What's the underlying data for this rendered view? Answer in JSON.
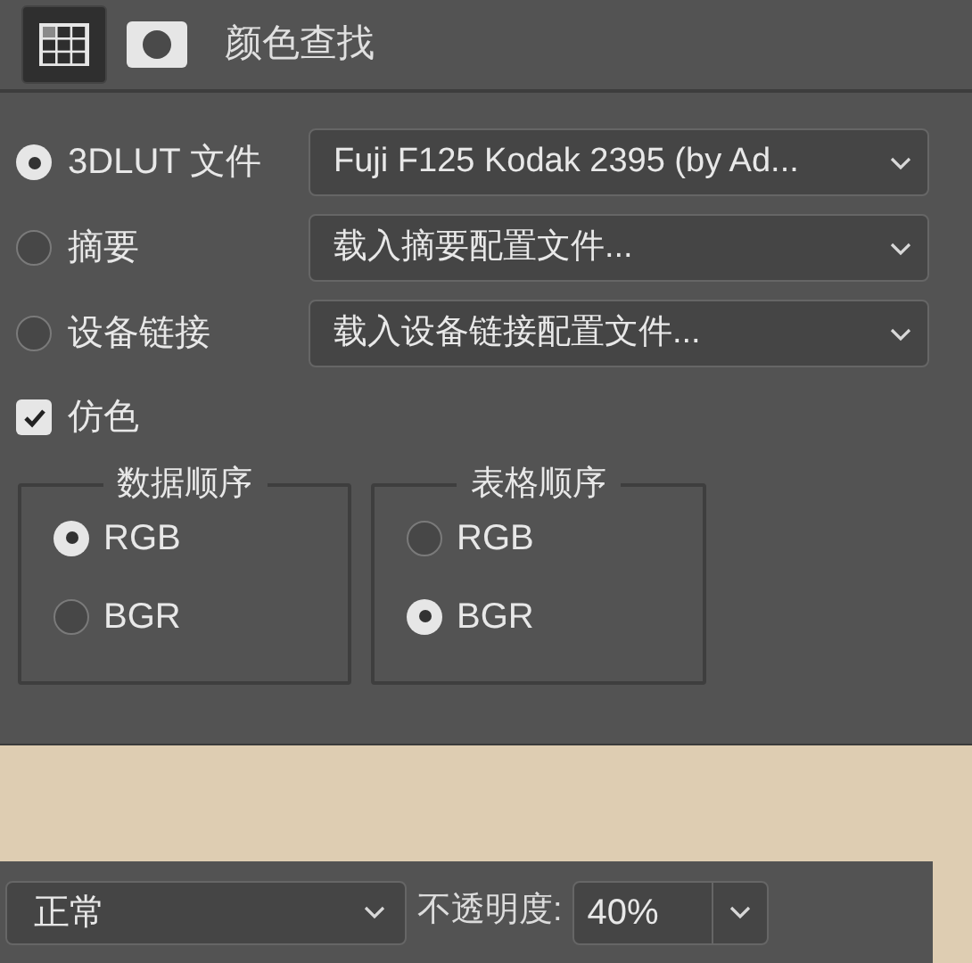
{
  "header": {
    "tabs": [
      {
        "kind": "grid",
        "selected": true
      },
      {
        "kind": "mask",
        "selected": false
      }
    ],
    "title": "颜色查找"
  },
  "sources": [
    {
      "label": "3DLUT 文件",
      "selected": true,
      "dropdown": "Fuji F125 Kodak 2395 (by Ad..."
    },
    {
      "label": "摘要",
      "selected": false,
      "dropdown": "载入摘要配置文件..."
    },
    {
      "label": "设备链接",
      "selected": false,
      "dropdown": "载入设备链接配置文件..."
    }
  ],
  "dither": {
    "label": "仿色",
    "checked": true
  },
  "groups": [
    {
      "title": "数据顺序",
      "options": [
        {
          "label": "RGB",
          "selected": true
        },
        {
          "label": "BGR",
          "selected": false
        }
      ]
    },
    {
      "title": "表格顺序",
      "options": [
        {
          "label": "RGB",
          "selected": false
        },
        {
          "label": "BGR",
          "selected": true
        }
      ]
    }
  ],
  "layers_bar": {
    "blend_mode": "正常",
    "opacity_label": "不透明度:",
    "opacity": "40%"
  }
}
